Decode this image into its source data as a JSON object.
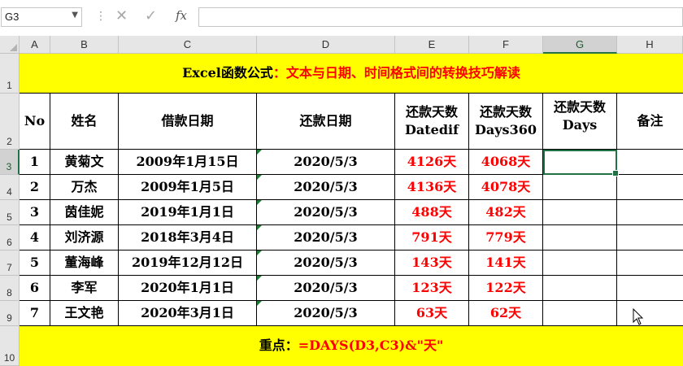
{
  "formula_bar": {
    "name_box": "G3",
    "fx_label": "fx",
    "formula": ""
  },
  "columns": [
    "A",
    "B",
    "C",
    "D",
    "E",
    "F",
    "G",
    "H"
  ],
  "selected_column": "G",
  "rows": [
    "1",
    "2",
    "3",
    "4",
    "5",
    "6",
    "7",
    "8",
    "9",
    "10"
  ],
  "selected_row": "3",
  "sheet": {
    "title_black": "Excel函数公式",
    "title_red": "：文本与日期、时间格式间的转换技巧解读",
    "headers": {
      "no": "No",
      "name": "姓名",
      "loan_date": "借款日期",
      "repay_date": "还款日期",
      "e_line1": "还款天数",
      "e_line2": "Datedif",
      "f_line1": "还款天数",
      "f_line2": "Days360",
      "g_line1": "还款天数",
      "g_line2": "Days",
      "remark": "备注"
    },
    "data_rows": [
      {
        "no": "1",
        "name": "黄菊文",
        "loan": "2009年1月15日",
        "repay": "2020/5/3",
        "datedif": "4126天",
        "days360": "4068天",
        "days": "",
        "remark": ""
      },
      {
        "no": "2",
        "name": "万杰",
        "loan": "2009年1月5日",
        "repay": "2020/5/3",
        "datedif": "4136天",
        "days360": "4078天",
        "days": "",
        "remark": ""
      },
      {
        "no": "3",
        "name": "茵佳妮",
        "loan": "2019年1月1日",
        "repay": "2020/5/3",
        "datedif": "488天",
        "days360": "482天",
        "days": "",
        "remark": ""
      },
      {
        "no": "4",
        "name": "刘济源",
        "loan": "2018年3月4日",
        "repay": "2020/5/3",
        "datedif": "791天",
        "days360": "779天",
        "days": "",
        "remark": ""
      },
      {
        "no": "5",
        "name": "董海峰",
        "loan": "2019年12月12日",
        "repay": "2020/5/3",
        "datedif": "143天",
        "days360": "141天",
        "days": "",
        "remark": ""
      },
      {
        "no": "6",
        "name": "李军",
        "loan": "2020年1月1日",
        "repay": "2020/5/3",
        "datedif": "123天",
        "days360": "122天",
        "days": "",
        "remark": ""
      },
      {
        "no": "7",
        "name": "王文艳",
        "loan": "2020年3月1日",
        "repay": "2020/5/3",
        "datedif": "63天",
        "days360": "62天",
        "days": "",
        "remark": ""
      }
    ],
    "footer_black": "重点：",
    "footer_red": "=DAYS(D3,C3)&\"天\""
  },
  "colors": {
    "fill_yellow": "#ffff00",
    "text_red": "#ff0000",
    "excel_green": "#217346"
  }
}
